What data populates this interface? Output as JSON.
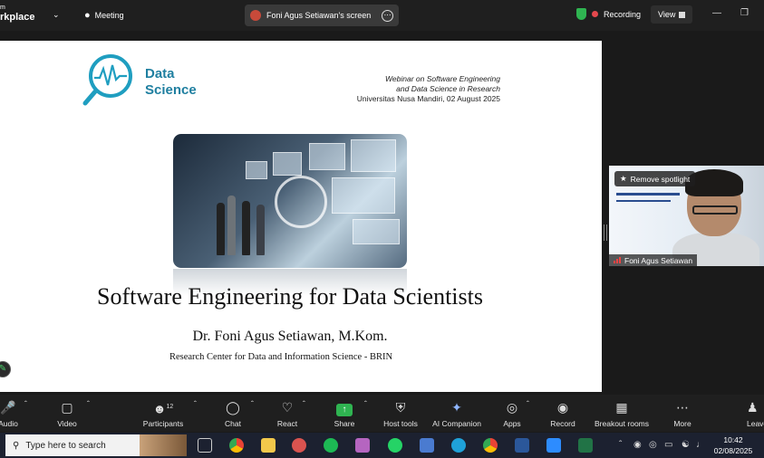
{
  "topbar": {
    "workspace_small": "m",
    "workspace": "rkplace",
    "meeting_label": "Meeting",
    "screen_share_label": "Foni Agus Setiawan's screen",
    "recording_label": "Recording",
    "view_label": "View"
  },
  "slide": {
    "logo_line1": "Data",
    "logo_line2": "Science",
    "webinar_line1": "Webinar on Software Engineering",
    "webinar_line2": "and Data Science in Research",
    "webinar_line3": "Universitas Nusa Mandiri, 02 August 2025",
    "title": "Software Engineering for Data Scientists",
    "author": "Dr. Foni Agus Setiawan, M.Kom.",
    "affiliation": "Research Center for Data and Information Science - BRIN"
  },
  "video": {
    "remove_spotlight": "Remove spotlight",
    "participant_name": "Foni Agus Setiawan"
  },
  "toolbar": {
    "audio": "Audio",
    "video": "Video",
    "participants": "Participants",
    "participants_count": "12",
    "chat": "Chat",
    "react": "React",
    "share": "Share",
    "host_tools": "Host tools",
    "ai_companion": "AI Companion",
    "apps": "Apps",
    "record": "Record",
    "breakout_rooms": "Breakout rooms",
    "more": "More",
    "leave": "Leave"
  },
  "taskbar": {
    "search_placeholder": "Type here to search",
    "time": "10:42",
    "date": "02/08/2025"
  },
  "colors": {
    "zoom_bg": "#1f1f1f",
    "share_green": "#2fb451",
    "logo_teal": "#1f7fa0",
    "taskbar": "#1c2130"
  }
}
